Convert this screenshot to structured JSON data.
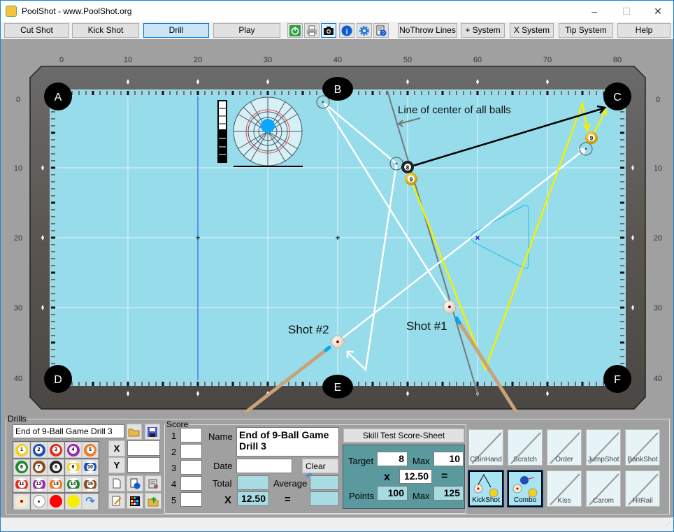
{
  "window": {
    "title": "PoolShot - www.PoolShot.org",
    "minimize": "–",
    "maximize": "☐",
    "close": "✕"
  },
  "toolbar": {
    "buttons": [
      "Cut Shot",
      "Kick Shot",
      "Drill",
      "Play"
    ],
    "selected": "Drill",
    "icons": [
      "power-icon",
      "printer-icon",
      "camera-icon",
      "info-icon",
      "settings-gear-icon",
      "help-document-icon"
    ],
    "right_buttons": [
      "NoThrow Lines",
      "+ System",
      "X System",
      "Tip System",
      "Help"
    ]
  },
  "table": {
    "x_ticks": [
      "0",
      "10",
      "20",
      "30",
      "40",
      "50",
      "60",
      "70",
      "80"
    ],
    "y_ticks": [
      "0",
      "10",
      "20",
      "30",
      "40"
    ],
    "pockets": [
      "A",
      "B",
      "C",
      "D",
      "E",
      "F"
    ],
    "annotation": "Line of center of all balls",
    "shot1_label": "Shot #1",
    "shot2_label": "Shot #2",
    "balls": {
      "eight": "8",
      "nine": "9",
      "nine_target": "9"
    },
    "felt_color": "#96dcea",
    "stroke_meter_fill": 0.6
  },
  "drills": {
    "legend": "Drills",
    "name": "End of 9-Ball Game Drill 3",
    "ball_buttons": [
      "1",
      "2",
      "3",
      "4",
      "5",
      "6",
      "7",
      "8",
      "9",
      "10",
      "11",
      "12",
      "13",
      "14",
      "15"
    ],
    "ball_colors": [
      "#f2d21a",
      "#1e4fb8",
      "#e0301e",
      "#9b2bb0",
      "#f07a1a",
      "#1a8a2a",
      "#8a4a1a",
      "#222222",
      "#f2d21a",
      "#1e4fb8",
      "#e0301e",
      "#9b2bb0",
      "#f07a1a",
      "#1a8a2a",
      "#8a4a1a"
    ],
    "x_label": "X",
    "y_label": "Y",
    "x_value": "",
    "y_value": ""
  },
  "score": {
    "legend": "Score",
    "rows": [
      "1",
      "2",
      "3",
      "4",
      "5"
    ],
    "name_label": "Name",
    "name_value": "End of 9-Ball Game Drill 3",
    "date_label": "Date",
    "date_value": "",
    "clear_label": "Clear",
    "total_label": "Total",
    "average_label": "Average",
    "x_label": "X",
    "multiplier": "12.50",
    "equals": "="
  },
  "skill": {
    "title": "Skill Test Score-Sheet",
    "target_label": "Target",
    "target": "8",
    "max_label": "Max",
    "max": "10",
    "x_label": "x",
    "multiplier": "12.50",
    "equals": "=",
    "points_label": "Points",
    "points": "100",
    "points_max_label": "Max",
    "points_max": "125"
  },
  "shot_types": [
    {
      "label": "CBinHand",
      "active": false
    },
    {
      "label": "Scratch",
      "active": false
    },
    {
      "label": "Order",
      "active": false
    },
    {
      "label": "JumpShot",
      "active": false
    },
    {
      "label": "BankShot",
      "active": false
    },
    {
      "label": "KickShot",
      "active": true
    },
    {
      "label": "Combo",
      "active": true
    },
    {
      "label": "Kiss",
      "active": false
    },
    {
      "label": "Carom",
      "active": false
    },
    {
      "label": "HitRail",
      "active": false
    }
  ]
}
